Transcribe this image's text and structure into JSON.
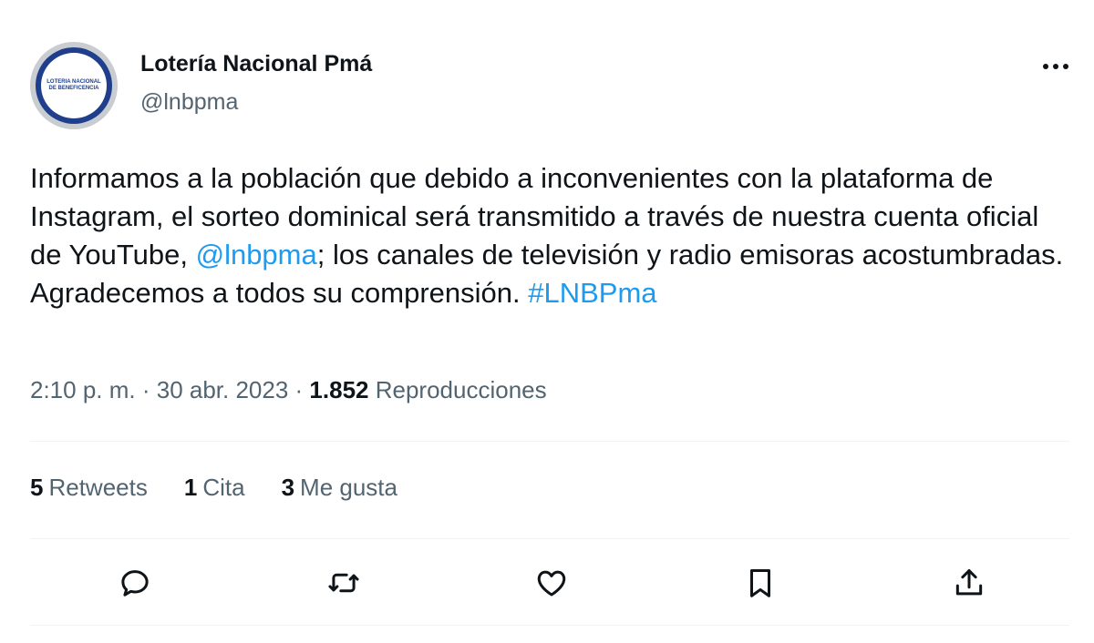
{
  "author": {
    "display_name": "Lotería Nacional Pmá",
    "handle": "@lnbpma",
    "avatar_text": "LOTERIA NACIONAL DE BENEFICENCIA"
  },
  "tweet": {
    "text_part1": "Informamos a la población que debido a inconvenientes con la plataforma de Instagram, el sorteo dominical será transmitido a través de nuestra cuenta oficial de YouTube, ",
    "mention": "@lnbpma",
    "text_part2": "; los canales de televisión y radio emisoras acostumbradas. Agradecemos a todos su comprensión. ",
    "hashtag": "#LNBPma"
  },
  "meta": {
    "time": "2:10 p. m.",
    "separator": " · ",
    "date": "30 abr. 2023",
    "views_count": "1.852",
    "views_label": "Reproducciones"
  },
  "stats": {
    "retweets_count": "5",
    "retweets_label": "Retweets",
    "quotes_count": "1",
    "quotes_label": "Cita",
    "likes_count": "3",
    "likes_label": "Me gusta"
  },
  "icons": {
    "more": "more-horizontal-icon",
    "reply": "reply-icon",
    "retweet": "retweet-icon",
    "like": "heart-icon",
    "bookmark": "bookmark-icon",
    "share": "share-icon"
  },
  "colors": {
    "link": "#1d9bf0",
    "secondary_text": "#536471",
    "primary_text": "#0f1419",
    "avatar_brand": "#1f3f8c"
  }
}
